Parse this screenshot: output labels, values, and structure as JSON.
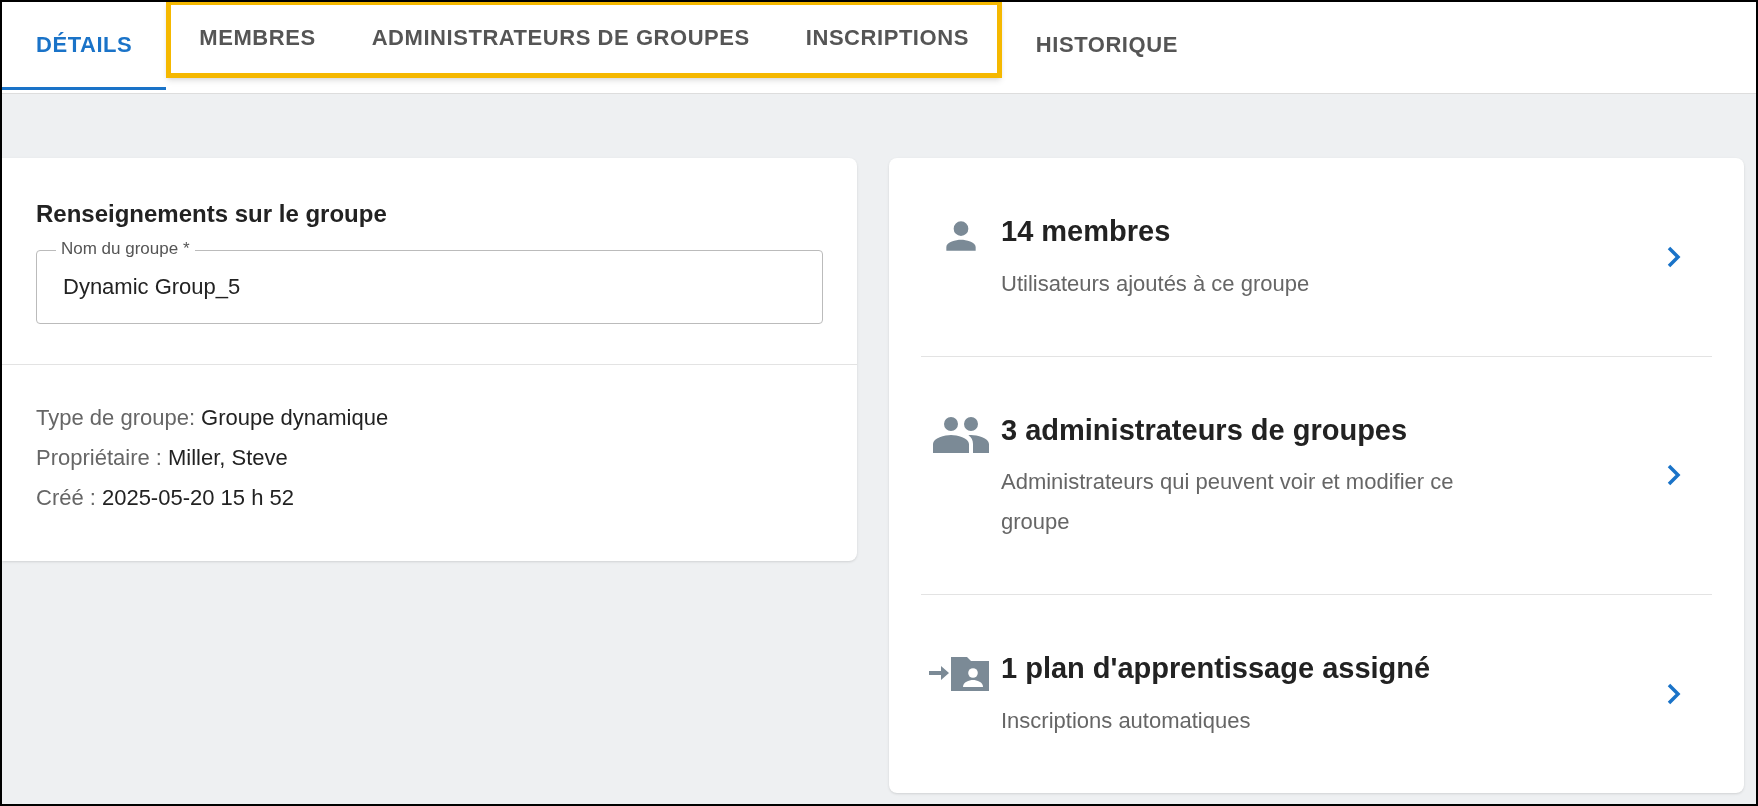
{
  "tabs": [
    {
      "label": "DÉTAILS",
      "selected": true,
      "highlighted": false
    },
    {
      "label": "MEMBRES",
      "selected": false,
      "highlighted": true
    },
    {
      "label": "ADMINISTRATEURS DE GROUPES",
      "selected": false,
      "highlighted": true
    },
    {
      "label": "INSCRIPTIONS",
      "selected": false,
      "highlighted": true
    },
    {
      "label": "HISTORIQUE",
      "selected": false,
      "highlighted": false
    }
  ],
  "group_info": {
    "title": "Renseignements sur le groupe",
    "name_field": {
      "label": "Nom du groupe *",
      "value": "Dynamic Group_5"
    },
    "details": [
      {
        "label": "Type de groupe:",
        "value": "Groupe dynamique"
      },
      {
        "label": "Propriétaire :",
        "value": "Miller, Steve"
      },
      {
        "label": "Créé :",
        "value": "2025-05-20 15 h 52"
      }
    ]
  },
  "summary": [
    {
      "kind": "person",
      "title": "14 membres",
      "subtitle": "Utilisateurs ajoutés à ce groupe"
    },
    {
      "kind": "people",
      "title": "3 administrateurs de groupes",
      "subtitle": "Administrateurs qui peuvent voir et modifier ce groupe"
    },
    {
      "kind": "plan",
      "title": "1 plan d'apprentissage assigné",
      "subtitle": "Inscriptions automatiques"
    }
  ]
}
